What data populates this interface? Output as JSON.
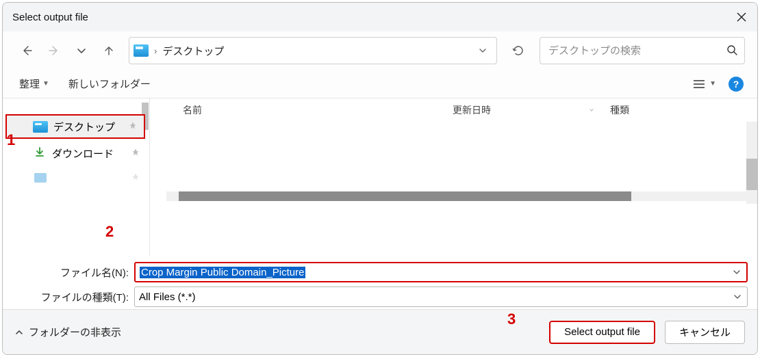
{
  "title": "Select output file",
  "nav": {
    "location": "デスクトップ",
    "search_placeholder": "デスクトップの検索"
  },
  "toolbar": {
    "organize": "整理",
    "new_folder": "新しいフォルダー"
  },
  "sidebar": {
    "items": [
      {
        "label": "デスクトップ"
      },
      {
        "label": "ダウンロード"
      },
      {
        "label": ""
      }
    ]
  },
  "columns": {
    "name": "名前",
    "date": "更新日時",
    "type": "種類"
  },
  "fields": {
    "filename_label": "ファイル名(N):",
    "filename_value": "Crop Margin Public Domain_Picture",
    "filetype_label": "ファイルの種類(T):",
    "filetype_value": "All Files (*.*)"
  },
  "footer": {
    "hide_folders": "フォルダーの非表示",
    "primary": "Select output file",
    "cancel": "キャンセル"
  },
  "callouts": {
    "c1": "1",
    "c2": "2",
    "c3": "3"
  }
}
